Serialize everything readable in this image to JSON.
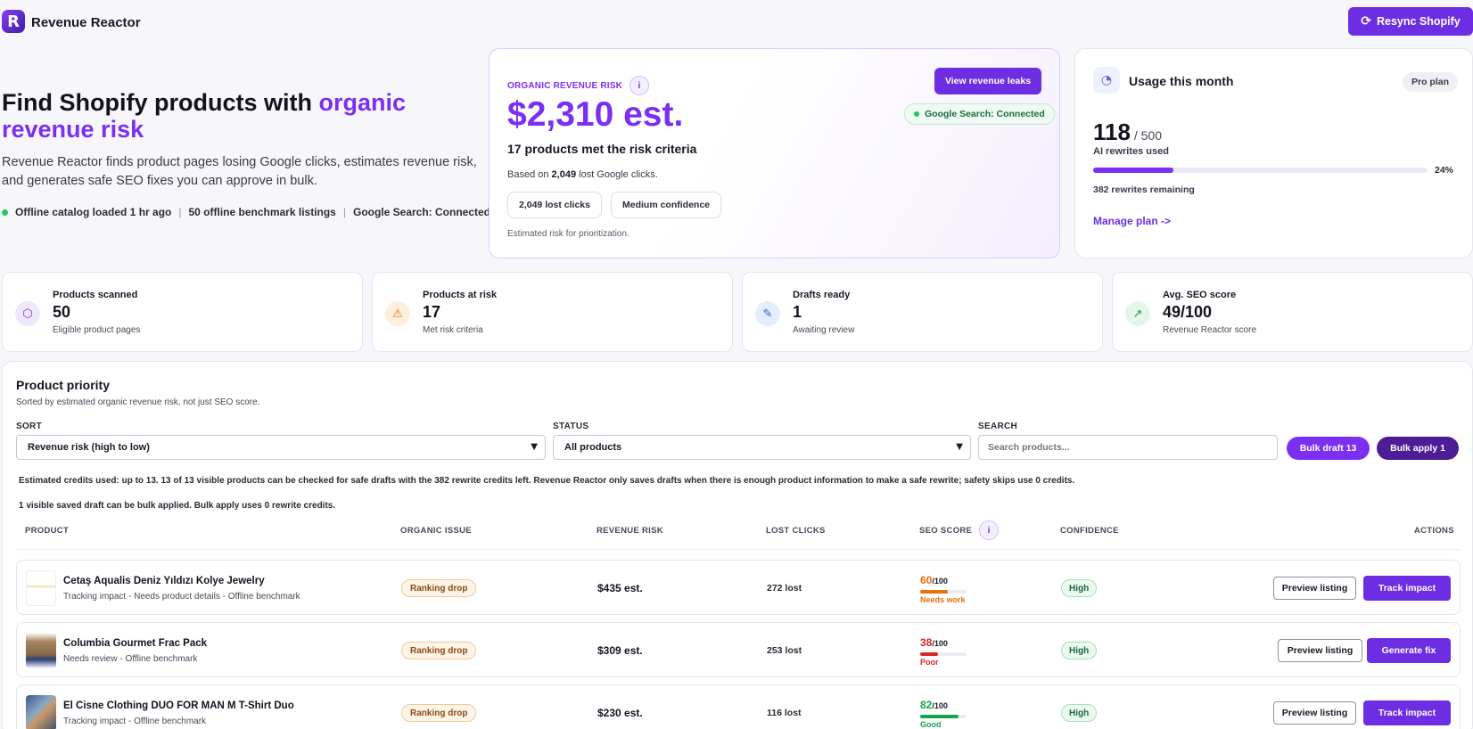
{
  "app": {
    "name": "Revenue Reactor",
    "logo_letter": "R",
    "resync_label": "Resync Shopify"
  },
  "hero": {
    "title_plain": "Find Shopify products with ",
    "title_accent": "organic revenue risk",
    "subtitle": "Revenue Reactor finds product pages losing Google clicks, estimates revenue risk, and generates safe SEO fixes you can approve in bulk.",
    "status_catalog": "Offline catalog loaded 1 hr ago",
    "status_benchmark": "50 offline benchmark listings",
    "status_google": "Google Search: Connected",
    "separator": "|"
  },
  "risk": {
    "label": "ORGANIC REVENUE RISK",
    "info": "i",
    "value": "$2,310 est.",
    "met": "17 products met the risk criteria",
    "based_prefix": "Based on ",
    "based_value": "2,049",
    "based_suffix": " lost Google clicks.",
    "pill_lost_value": "2,049",
    "pill_lost_label": " lost clicks",
    "pill_conf_value": "Medium",
    "pill_conf_label": " confidence",
    "footnote": "Estimated risk for prioritization.",
    "view_button": "View revenue leaks",
    "google_badge": "Google Search: Connected"
  },
  "usage": {
    "title": "Usage this month",
    "plan": "Pro plan",
    "used": "118",
    "of_total": " / 500",
    "used_label": "AI rewrites used",
    "percent_value": 0.24,
    "percent_label": "24%",
    "remaining": "382 rewrites remaining",
    "manage": "Manage plan ->"
  },
  "stats": [
    {
      "label": "Products scanned",
      "value": "50",
      "sub": "Eligible product pages",
      "icon": "cube-icon",
      "glyph": "⬡",
      "bg": "#efe8fd",
      "fg": "#7b2ff2"
    },
    {
      "label": "Products at risk",
      "value": "17",
      "sub": "Met risk criteria",
      "icon": "warning-icon",
      "glyph": "⚠",
      "bg": "#fdeedd",
      "fg": "#e0720f"
    },
    {
      "label": "Drafts ready",
      "value": "1",
      "sub": "Awaiting review",
      "icon": "pencil-icon",
      "glyph": "✎",
      "bg": "#e4edfd",
      "fg": "#2f5fd6"
    },
    {
      "label": "Avg. SEO score",
      "value": "49/100",
      "sub": "Revenue Reactor score",
      "icon": "trending-up-icon",
      "glyph": "↗",
      "bg": "#e2f7ea",
      "fg": "#1a9a4a"
    }
  ],
  "priority": {
    "title": "Product priority",
    "subtitle": "Sorted by estimated organic revenue risk, not just SEO score.",
    "sort_label": "SORT",
    "sort_value": "Revenue risk (high to low)",
    "status_label": "STATUS",
    "status_value": "All products",
    "search_label": "SEARCH",
    "search_placeholder": "Search products...",
    "bulk_draft": "Bulk draft 13",
    "bulk_apply": "Bulk apply 1",
    "note_credits": "Estimated credits used: up to 13. 13 of 13 visible products can be checked for safe drafts with the 382 rewrite credits left. Revenue Reactor only saves drafts when there is enough product information to make a safe rewrite; safety skips use 0 credits.",
    "note_saved": "1 visible saved draft can be bulk applied. Bulk apply uses 0 rewrite credits.",
    "headers": {
      "product": "PRODUCT",
      "issue": "ORGANIC ISSUE",
      "risk": "REVENUE RISK",
      "lost": "LOST CLICKS",
      "seo": "SEO SCORE",
      "seo_info": "i",
      "confidence": "CONFIDENCE",
      "actions": "ACTIONS"
    },
    "rows": [
      {
        "name": "Cetaş Aqualis Deniz Yıldızı Kolye Jewelry",
        "meta": "Tracking impact - Needs product details - Offline benchmark",
        "issue": "Ranking drop",
        "risk": "$435 est.",
        "lost": "272 lost",
        "seo": "60",
        "seo_den": "/100",
        "seo_fraction": 0.6,
        "seo_label": "Needs work",
        "seo_color": "#e8710a",
        "confidence": "High",
        "preview": "Preview listing",
        "action": "Track impact"
      },
      {
        "name": "Columbia Gourmet Frac Pack",
        "meta": "Needs review - Offline benchmark",
        "issue": "Ranking drop",
        "risk": "$309 est.",
        "lost": "253 lost",
        "seo": "38",
        "seo_den": "/100",
        "seo_fraction": 0.38,
        "seo_label": "Poor",
        "seo_color": "#dc2626",
        "confidence": "High",
        "preview": "Preview listing",
        "action": "Generate fix"
      },
      {
        "name": "El Cisne Clothing DUO FOR MAN M T-Shirt Duo",
        "meta": "Tracking impact - Offline benchmark",
        "issue": "Ranking drop",
        "risk": "$230 est.",
        "lost": "116 lost",
        "seo": "82",
        "seo_den": "/100",
        "seo_fraction": 0.82,
        "seo_label": "Good",
        "seo_color": "#16a34a",
        "confidence": "High",
        "preview": "Preview listing",
        "action": "Track impact"
      }
    ]
  }
}
